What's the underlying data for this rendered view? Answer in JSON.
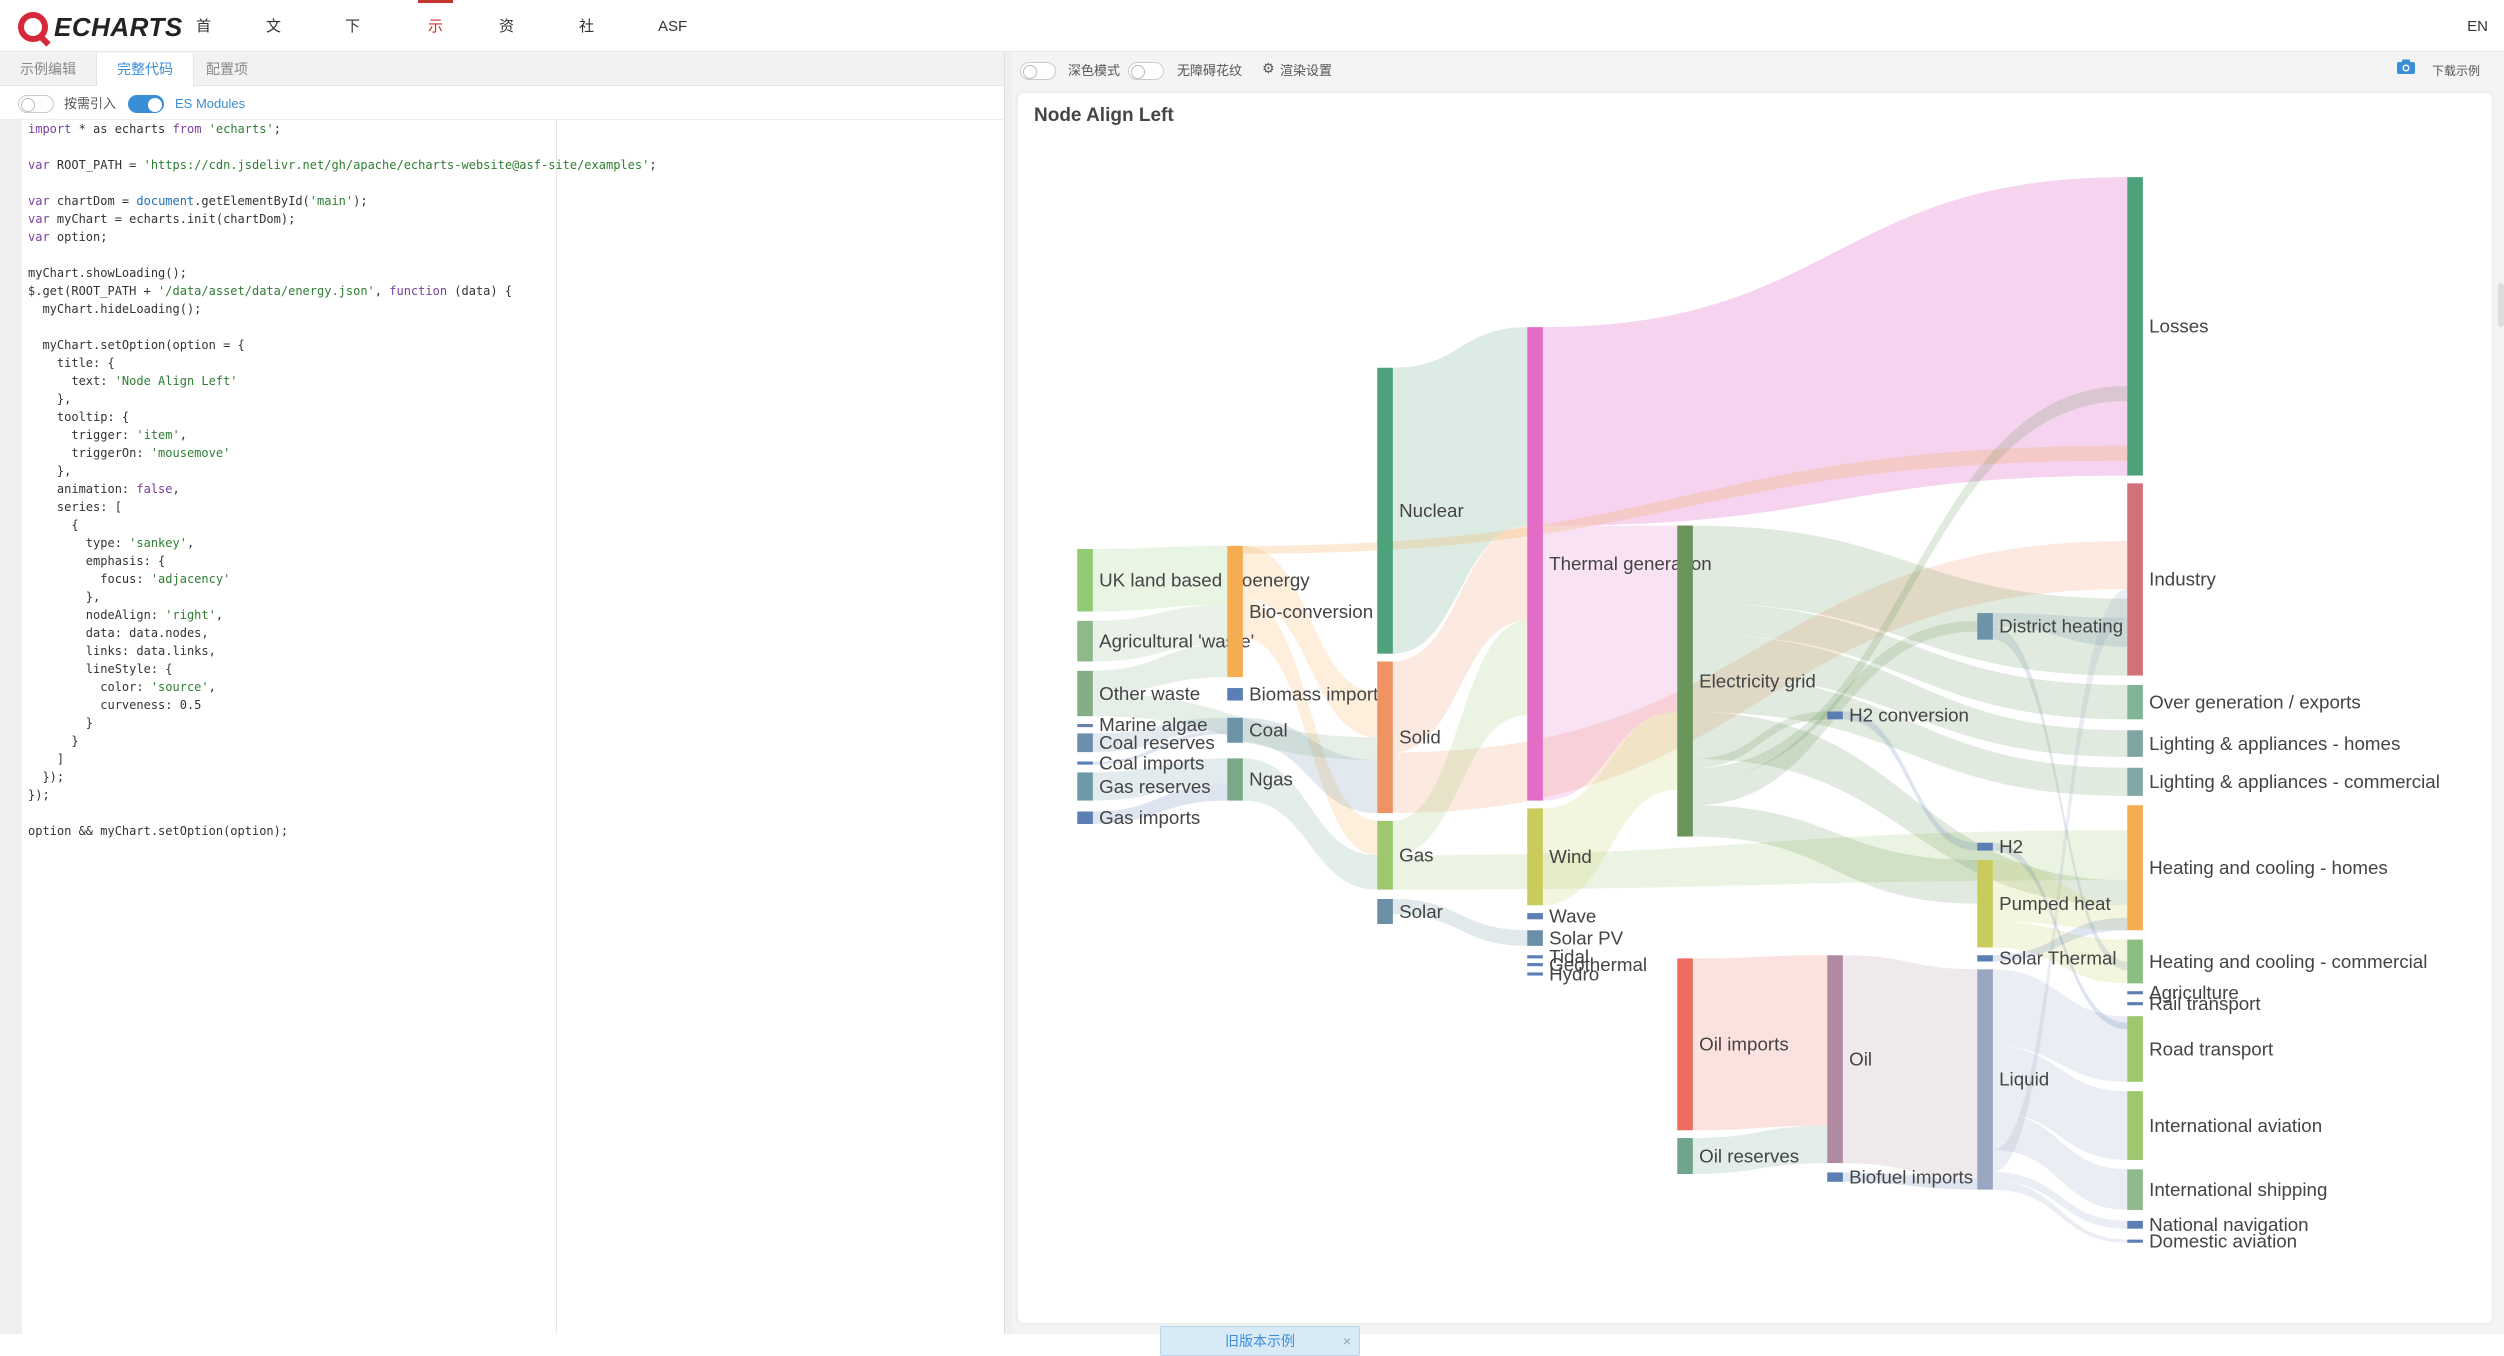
{
  "nav": {
    "logo_text": "ECHARTS",
    "items": [
      {
        "label": "首页",
        "has_caret": false,
        "active": false
      },
      {
        "label": "文档",
        "has_caret": true,
        "active": false
      },
      {
        "label": "下载",
        "has_caret": true,
        "active": false
      },
      {
        "label": "示例",
        "has_caret": false,
        "active": true
      },
      {
        "label": "资源",
        "has_caret": true,
        "active": false
      },
      {
        "label": "社区",
        "has_caret": true,
        "active": false
      },
      {
        "label": "ASF",
        "has_caret": true,
        "active": false
      }
    ],
    "lang": "EN"
  },
  "editor": {
    "tabs": [
      {
        "label": "示例编辑",
        "active": false
      },
      {
        "label": "完整代码",
        "active": true
      },
      {
        "label": "配置项",
        "active": false
      }
    ],
    "toggles": [
      {
        "label": "按需引入",
        "on": false
      },
      {
        "label": "ES Modules",
        "on": true
      }
    ],
    "code_lines": [
      "import * as echarts from 'echarts';",
      "",
      "var ROOT_PATH = 'https://cdn.jsdelivr.net/gh/apache/echarts-website@asf-site/examples';",
      "",
      "var chartDom = document.getElementById('main');",
      "var myChart = echarts.init(chartDom);",
      "var option;",
      "",
      "myChart.showLoading();",
      "$.get(ROOT_PATH + '/data/asset/data/energy.json', function (data) {",
      "  myChart.hideLoading();",
      "",
      "  myChart.setOption(option = {",
      "    title: {",
      "      text: 'Node Align Left'",
      "    },",
      "    tooltip: {",
      "      trigger: 'item',",
      "      triggerOn: 'mousemove'",
      "    },",
      "    animation: false,",
      "    series: [",
      "      {",
      "        type: 'sankey',",
      "        emphasis: {",
      "          focus: 'adjacency'",
      "        },",
      "        nodeAlign: 'right',",
      "        data: data.nodes,",
      "        links: data.links,",
      "        lineStyle: {",
      "          color: 'source',",
      "          curveness: 0.5",
      "        }",
      "      }",
      "    ]",
      "  });",
      "});",
      "",
      "option && myChart.setOption(option);"
    ]
  },
  "preview": {
    "toggles": [
      {
        "label": "深色模式",
        "on": false
      },
      {
        "label": "无障碍花纹",
        "on": false
      }
    ],
    "render_settings_label": "渲染设置",
    "download_label": "下载示例",
    "old_version_label": "旧版本示例",
    "old_version_close": "×"
  },
  "chart_data": {
    "type": "sankey",
    "title": "Node Align Left",
    "node_align": "right",
    "columns": [
      {
        "nodes": [
          {
            "name": "UK land based bioenergy",
            "color": "#91cc75"
          },
          {
            "name": "Agricultural 'waste'",
            "color": "#8fb88b"
          },
          {
            "name": "Other waste",
            "color": "#83ad85"
          },
          {
            "name": "Marine algae",
            "color": "#6582ac"
          },
          {
            "name": "Coal reserves",
            "color": "#6d8fad"
          },
          {
            "name": "Coal imports",
            "color": "#5b7fb4"
          },
          {
            "name": "Gas reserves",
            "color": "#6c9aa6"
          },
          {
            "name": "Gas imports",
            "color": "#5b7fb4"
          }
        ]
      },
      {
        "nodes": [
          {
            "name": "Bio-conversion",
            "color": "#f5ad52"
          },
          {
            "name": "Biomass imports",
            "color": "#5b7fb4"
          },
          {
            "name": "Coal",
            "color": "#6c93a8"
          },
          {
            "name": "Ngas",
            "color": "#7aa98a"
          }
        ]
      },
      {
        "nodes": [
          {
            "name": "Nuclear",
            "color": "#4ea27a"
          },
          {
            "name": "Solid",
            "color": "#f09363"
          },
          {
            "name": "Gas",
            "color": "#9dc86e"
          },
          {
            "name": "Solar",
            "color": "#6a8fa7"
          }
        ]
      },
      {
        "nodes": [
          {
            "name": "Thermal generation",
            "color": "#e26cc6"
          },
          {
            "name": "Wind",
            "color": "#c9cb5d"
          },
          {
            "name": "Wave",
            "color": "#5b7fb4"
          },
          {
            "name": "Solar PV",
            "color": "#6a8fa7"
          },
          {
            "name": "Tidal",
            "color": "#5b7fb4"
          },
          {
            "name": "Geothermal",
            "color": "#5b7fb4"
          },
          {
            "name": "Hydro",
            "color": "#5b7fb4"
          }
        ]
      },
      {
        "nodes": [
          {
            "name": "Electricity grid",
            "color": "#69945a"
          },
          {
            "name": "Oil imports",
            "color": "#ee6c5f"
          },
          {
            "name": "Oil reserves",
            "color": "#6fa58b"
          }
        ]
      },
      {
        "nodes": [
          {
            "name": "H2 conversion",
            "color": "#5b7fb4"
          },
          {
            "name": "Oil",
            "color": "#b08aa1"
          },
          {
            "name": "Biofuel imports",
            "color": "#5b7fb4"
          }
        ]
      },
      {
        "nodes": [
          {
            "name": "District heating",
            "color": "#6c93a8"
          },
          {
            "name": "H2",
            "color": "#5b7fb4"
          },
          {
            "name": "Pumped heat",
            "color": "#c9cb5d"
          },
          {
            "name": "Solar Thermal",
            "color": "#5b7fb4"
          },
          {
            "name": "Liquid",
            "color": "#98a6c2"
          }
        ]
      },
      {
        "nodes": [
          {
            "name": "Losses",
            "color": "#4ea27a"
          },
          {
            "name": "Industry",
            "color": "#d27178"
          },
          {
            "name": "Over generation / exports",
            "color": "#7fb497"
          },
          {
            "name": "Lighting & appliances - homes",
            "color": "#7ea5a2"
          },
          {
            "name": "Lighting & appliances - commercial",
            "color": "#80a8a6"
          },
          {
            "name": "Heating and cooling - homes",
            "color": "#f5ad52"
          },
          {
            "name": "Heating and cooling - commercial",
            "color": "#8bbf82"
          },
          {
            "name": "Agriculture",
            "color": "#5b7fb4"
          },
          {
            "name": "Rail transport",
            "color": "#5b7fb4"
          },
          {
            "name": "Road transport",
            "color": "#9dc86e"
          },
          {
            "name": "International aviation",
            "color": "#9dc86e"
          },
          {
            "name": "International shipping",
            "color": "#8fb88b"
          },
          {
            "name": "National navigation",
            "color": "#5b7fb4"
          },
          {
            "name": "Domestic aviation",
            "color": "#5b7fb4"
          }
        ]
      }
    ]
  }
}
